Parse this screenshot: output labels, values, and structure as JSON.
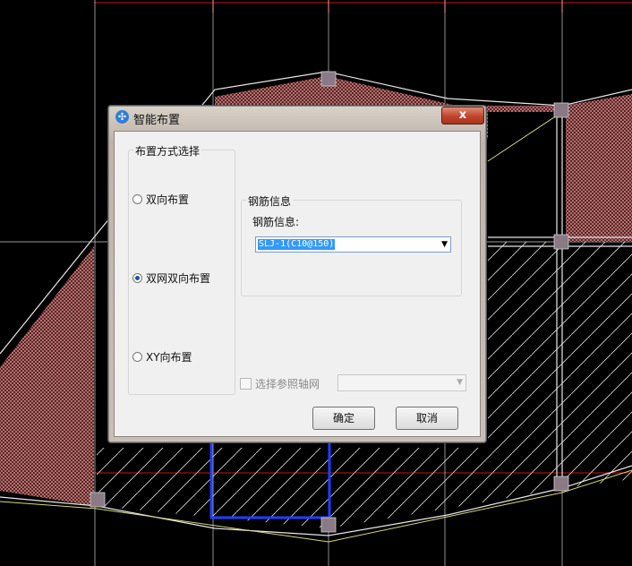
{
  "dialog": {
    "title": "智能布置",
    "close_label": "x",
    "layout_group": {
      "caption": "布置方式选择",
      "options": [
        {
          "label": "双向布置",
          "selected": false
        },
        {
          "label": "双网双向布置",
          "selected": true
        },
        {
          "label": "XY向布置",
          "selected": false
        }
      ]
    },
    "rebar_group": {
      "caption": "钢筋信息",
      "field_label": "钢筋信息:",
      "value": "SLJ-1(C10@150)"
    },
    "reference_axis": {
      "label": "选择参照轴网",
      "checked": false,
      "value": ""
    },
    "ok_label": "确定",
    "cancel_label": "取消"
  },
  "colors": {
    "canvas_bg": "#000000",
    "hatch": "#c07070",
    "slab_hatch": "#ffffff",
    "highlight": "#1f3fff",
    "selection": "#3399ff"
  }
}
